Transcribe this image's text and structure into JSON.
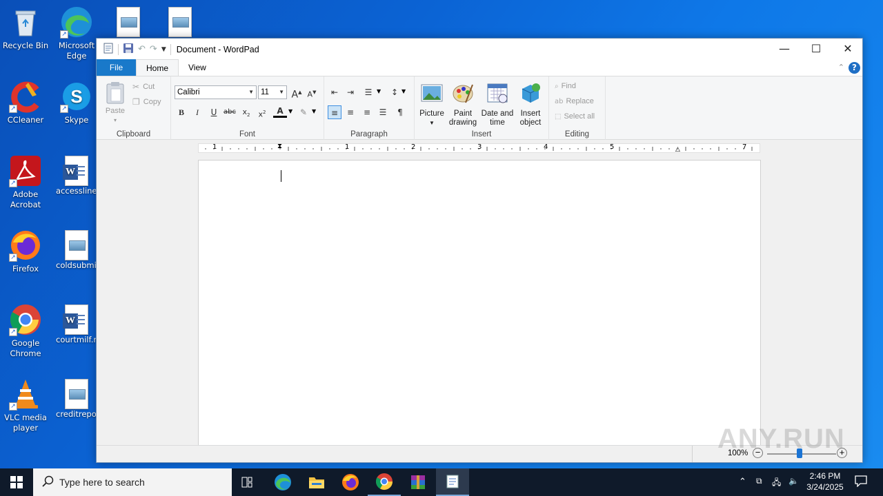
{
  "desktop": {
    "icons": [
      {
        "label": "Recycle Bin",
        "icon": "recycle-bin-icon"
      },
      {
        "label": "Microsoft",
        "label2": "Edge",
        "icon": "edge-icon"
      },
      {
        "label": "CCleaner",
        "icon": "ccleaner-icon"
      },
      {
        "label": "Skype",
        "icon": "skype-icon"
      },
      {
        "label": "Adobe",
        "label2": "Acrobat",
        "icon": "acrobat-icon"
      },
      {
        "label": "accessline.rtf",
        "icon": "word-doc-icon"
      },
      {
        "label": "Firefox",
        "icon": "firefox-icon"
      },
      {
        "label": "coldsubmit.png",
        "icon": "image-file-icon"
      },
      {
        "label": "Google",
        "label2": "Chrome",
        "icon": "chrome-icon"
      },
      {
        "label": "courtmilf.rtf",
        "icon": "word-doc-icon"
      },
      {
        "label": "VLC media",
        "label2": "player",
        "icon": "vlc-icon"
      },
      {
        "label": "creditreport.png",
        "icon": "image-file-icon"
      }
    ]
  },
  "window": {
    "title": "Document - WordPad",
    "tabs": {
      "file": "File",
      "home": "Home",
      "view": "View"
    },
    "ribbon": {
      "clipboard": {
        "label": "Clipboard",
        "paste": "Paste",
        "cut": "Cut",
        "copy": "Copy"
      },
      "font": {
        "label": "Font",
        "family": "Calibri",
        "size": "11"
      },
      "paragraph": {
        "label": "Paragraph"
      },
      "insert": {
        "label": "Insert",
        "picture": "Picture",
        "paint_1": "Paint",
        "paint_2": "drawing",
        "date_1": "Date and",
        "date_2": "time",
        "object_1": "Insert",
        "object_2": "object"
      },
      "editing": {
        "label": "Editing",
        "find": "Find",
        "replace": "Replace",
        "select_all": "Select all"
      }
    },
    "ruler_numbers": [
      "1",
      "1",
      "2",
      "3",
      "4",
      "5",
      "7"
    ],
    "status": {
      "zoom": "100%"
    }
  },
  "taskbar": {
    "search_placeholder": "Type here to search",
    "time": "2:46 PM",
    "date": "3/24/2025"
  },
  "watermark": "ANY.RUN"
}
